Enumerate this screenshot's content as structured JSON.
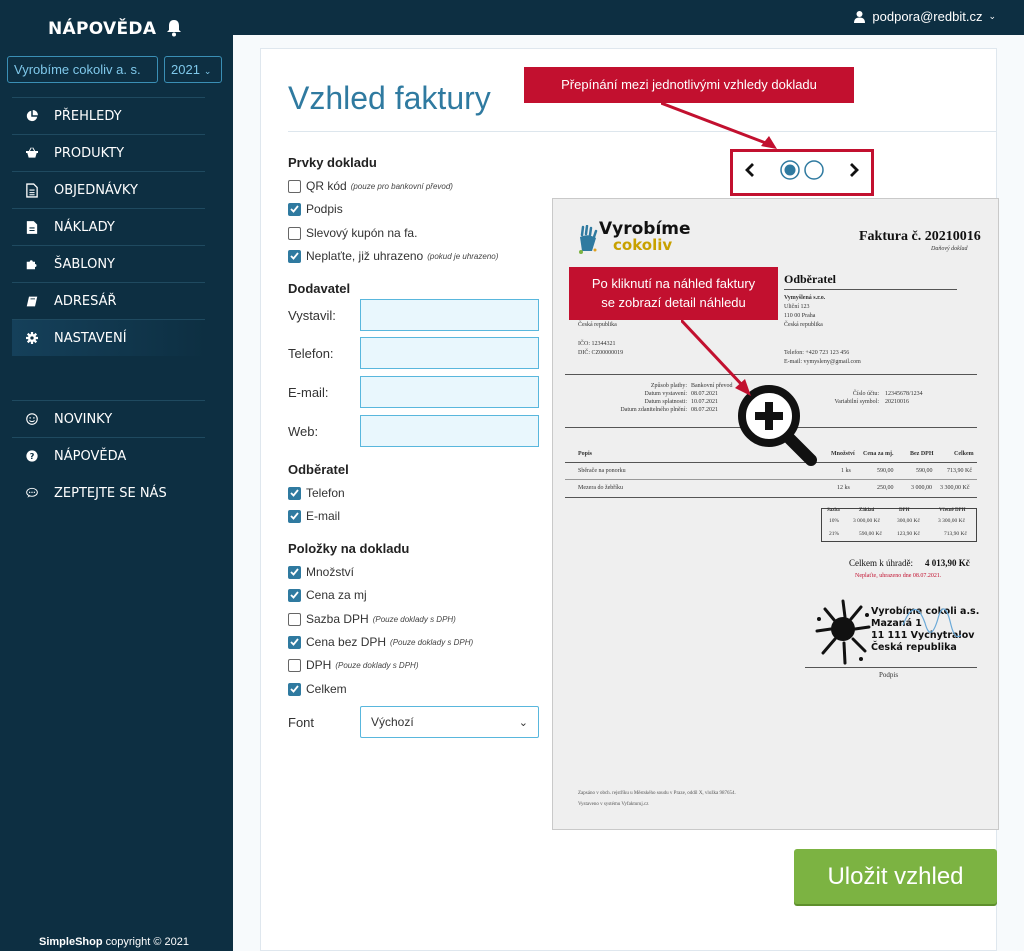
{
  "sidebar": {
    "brand": "NÁPOVĚDA",
    "company_select": "Vyrobíme cokoliv a. s.",
    "year_select": "2021",
    "items": [
      {
        "label": "PŘEHLEDY",
        "icon": "pie-chart-icon"
      },
      {
        "label": "PRODUKTY",
        "icon": "basket-icon"
      },
      {
        "label": "OBJEDNÁVKY",
        "icon": "document-icon"
      },
      {
        "label": "NÁKLADY",
        "icon": "file-icon"
      },
      {
        "label": "ŠABLONY",
        "icon": "puzzle-icon"
      },
      {
        "label": "ADRESÁŘ",
        "icon": "book-icon"
      },
      {
        "label": "NASTAVENÍ",
        "icon": "gear-icon"
      }
    ],
    "items2": [
      {
        "label": "NOVINKY",
        "icon": "smiley-icon"
      },
      {
        "label": "NÁPOVĚDA",
        "icon": "question-icon"
      },
      {
        "label": "ZEPTEJTE SE NÁS",
        "icon": "chat-icon"
      }
    ],
    "copyright_brand": "SimpleShop",
    "copyright_text": "copyright © 2021"
  },
  "topbar": {
    "user": "podpora@redbit.cz"
  },
  "page": {
    "title": "Vzhled faktury",
    "section_elements": "Prvky dokladu",
    "elements": [
      {
        "label": "QR kód",
        "note": "(pouze pro bankovní převod)",
        "checked": false
      },
      {
        "label": "Podpis",
        "note": "",
        "checked": true
      },
      {
        "label": "Slevový kupón na fa.",
        "note": "",
        "checked": false
      },
      {
        "label": "Neplaťte, již uhrazeno",
        "note": "(pokud je uhrazeno)",
        "checked": true
      }
    ],
    "section_supplier": "Dodavatel",
    "supplier_fields": [
      "Vystavil:",
      "Telefon:",
      "E-mail:",
      "Web:"
    ],
    "section_customer": "Odběratel",
    "customer": [
      {
        "label": "Telefon",
        "note": "",
        "checked": true
      },
      {
        "label": "E-mail",
        "note": "",
        "checked": true
      }
    ],
    "section_items": "Položky na dokladu",
    "items": [
      {
        "label": "Množství",
        "note": "",
        "checked": true
      },
      {
        "label": "Cena za mj",
        "note": "",
        "checked": true
      },
      {
        "label": "Sazba DPH",
        "note": "(Pouze doklady s DPH)",
        "checked": false
      },
      {
        "label": "Cena bez DPH",
        "note": "(Pouze doklady s DPH)",
        "checked": true
      },
      {
        "label": "DPH",
        "note": "(Pouze doklady s DPH)",
        "checked": false
      },
      {
        "label": "Celkem",
        "note": "",
        "checked": true
      }
    ],
    "font_label": "Font",
    "font_value": "Výchozí",
    "save_button": "Uložit vzhled",
    "callout_switch": "Přepínání mezi jednotlivými vzhledy dokladu",
    "callout_preview_1": "Po kliknutí na náhled faktury",
    "callout_preview_2": "se zobrazí detail náhledu"
  },
  "invoice": {
    "logo_line1": "Vyrobíme",
    "logo_line2": "cokoliv",
    "title": "Faktura č. 20210016",
    "subtitle": "Daňový doklad",
    "customer_heading": "Odběratel",
    "customer_lines": [
      "Vymyšlená s.r.o.",
      "Uliční 123",
      "110 00 Praha",
      "Česká republika"
    ],
    "supplier_country": "Česká republika",
    "ico": "IČO: 12344321",
    "dic": "DIČ: CZ00000019",
    "phone": "Telefon: +420 723 123 456",
    "email": "E-mail: vymysleny@gmail.com",
    "pay_labels": [
      "Způsob platby:",
      "Datum vystavení:",
      "Datum splatnosti:",
      "Datum zdanitelného plnění:"
    ],
    "pay_values": [
      "Bankovní převod",
      "08.07.2021",
      "10.07.2021",
      "08.07.2021"
    ],
    "acc_labels": [
      "Číslo účtu:",
      "Variabilní symbol:"
    ],
    "acc_values": [
      "12345678/1234",
      "20210016"
    ],
    "table_head": [
      "Popis",
      "Množství",
      "Cena za mj.",
      "Bez DPH",
      "Celkem"
    ],
    "rows": [
      [
        "Sběrače na ponorku",
        "1 ks",
        "590,00",
        "590,00",
        "713,90 Kč"
      ],
      [
        "Mezera do žebříku",
        "12 ks",
        "250,00",
        "3 000,00",
        "3 300,00 Kč"
      ]
    ],
    "vat_head": [
      "Sazba",
      "Základ",
      "DPH",
      "Včetně DPH"
    ],
    "vat_rows": [
      [
        "10%",
        "3 000,00 Kč",
        "300,00 Kč",
        "3 300,00 Kč"
      ],
      [
        "21%",
        "590,00 Kč",
        "123,90 Kč",
        "713,90 Kč"
      ]
    ],
    "total_label": "Celkem k úhradě:",
    "total_value": "4 013,90 Kč",
    "paid_note": "Neplaťte, uhrazeno dne 08.07.2021.",
    "stamp_lines": [
      "Vyrobíme cokoli a.s.",
      "Mazaná 1",
      "11 111 Vychytralov",
      "Česká republika"
    ],
    "sign_label": "Podpis",
    "footer1": "Zapsáno v obch. rejstříku u Městského soudu v Praze, oddíl X, vložka 987654.",
    "footer2": "Vystaveno v systému Vyfakturuj.cz"
  },
  "colors": {
    "sidebar": "#0d2f42",
    "accent": "#2f7aa0",
    "callout": "#c2102f",
    "save": "#7cb342",
    "input_bg": "#e9f7fd"
  }
}
